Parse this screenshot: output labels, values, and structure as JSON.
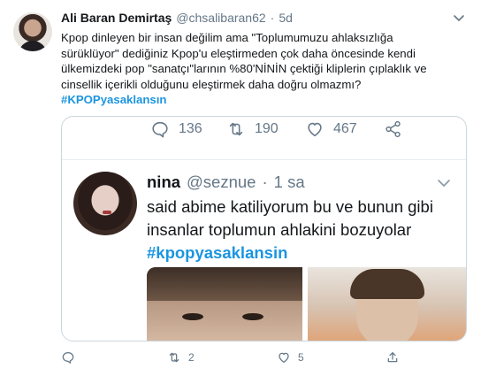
{
  "tweet": {
    "name": "Ali Baran Demirtaş",
    "handle": "@chsalibaran62",
    "separator": "·",
    "time": "5d",
    "lines": [
      "Kpop dinleyen bir insan değilim ama \"Toplumumuzu ahlaksızlığa",
      "sürüklüyor\" dediğiniz Kpop'u eleştirmeden çok daha öncesinde kendi",
      "ülkemizdeki pop \"sanatçı\"larının %80'NİNİN çektiği kliplerin çıplaklık ve",
      "cinsellik içerikli olduğunu eleştirmek daha doğru olmazmı?"
    ],
    "hashtag": "#KPOPyasaklansın",
    "actions": {
      "reply_count": "",
      "retweet_count": "2",
      "like_count": "5"
    }
  },
  "quoted": {
    "actions": {
      "reply_count": "136",
      "retweet_count": "190",
      "like_count": "467"
    },
    "name": "nina",
    "handle": "@seznue",
    "separator": "·",
    "time": "1 sa",
    "lines": [
      "said abime katiliyorum bu ve bunun gibi",
      "insanlar toplumun ahlakini bozuyolar"
    ],
    "hashtag": "#kpopyasaklansin"
  },
  "colors": {
    "link": "#1b95e0",
    "secondary_text": "#657786",
    "border": "#ccd6dd"
  }
}
